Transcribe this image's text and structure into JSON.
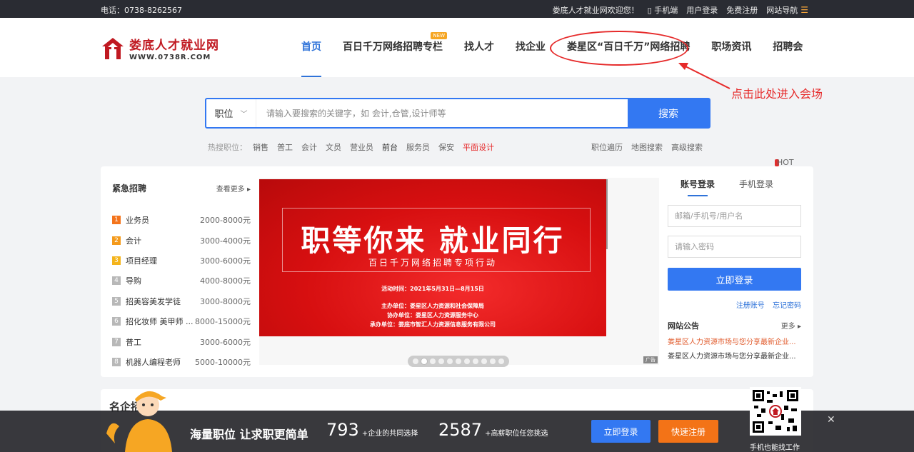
{
  "topbar": {
    "phone": "电话：0738-8262567",
    "welcome": "娄底人才就业网欢迎您！",
    "mobile": "手机端",
    "user_login": "用户登录",
    "free_register": "免费注册",
    "site_nav": "网站导航"
  },
  "logo": {
    "cn": "娄底人才就业网",
    "en": "WWW.0738R.COM"
  },
  "nav": {
    "items": [
      {
        "label": "首页"
      },
      {
        "label": "百日千万网络招聘专栏",
        "badge": "NEW"
      },
      {
        "label": "找人才"
      },
      {
        "label": "找企业"
      },
      {
        "label": "娄星区“百日千万”网络招聘",
        "badge": "HOT"
      },
      {
        "label": "职场资讯"
      },
      {
        "label": "招聘会"
      }
    ],
    "annotation": "点击此处进入会场"
  },
  "search": {
    "type": "职位",
    "placeholder": "请输入要搜索的关键字，如 会计,仓管,设计师等",
    "button": "搜索"
  },
  "hot": {
    "label": "热搜职位：",
    "items": [
      "销售",
      "普工",
      "会计",
      "文员",
      "营业员",
      "前台",
      "服务员",
      "保安",
      "平面设计"
    ],
    "links": [
      "职位遍历",
      "地图搜索",
      "高级搜索"
    ]
  },
  "urgent": {
    "title": "紧急招聘",
    "more": "查看更多",
    "items": [
      {
        "rank": "1",
        "job": "业务员",
        "salary": "2000-8000元"
      },
      {
        "rank": "2",
        "job": "会计",
        "salary": "3000-4000元"
      },
      {
        "rank": "3",
        "job": "项目经理",
        "salary": "3000-6000元"
      },
      {
        "rank": "4",
        "job": "导购",
        "salary": "4000-8000元"
      },
      {
        "rank": "5",
        "job": "招美容美发学徒",
        "salary": "3000-8000元"
      },
      {
        "rank": "6",
        "job": "招化妆师 美甲师 ...",
        "salary": "8000-15000元"
      },
      {
        "rank": "7",
        "job": "普工",
        "salary": "3000-6000元"
      },
      {
        "rank": "8",
        "job": "机器人编程老师",
        "salary": "5000-10000元"
      }
    ]
  },
  "banner": {
    "headline": "职等你来  就业同行",
    "subtitle": "百日千万网络招聘专项行动",
    "lines": [
      "活动时间：2021年5月31日—8月15日",
      "主办单位：娄星区人力资源和社会保障局",
      "协办单位：娄星区人力资源服务中心",
      "承办单位：娄底市智汇人力资源信息服务有限公司"
    ],
    "ad": "广告"
  },
  "login": {
    "tab_account": "账号登录",
    "tab_phone": "手机登录",
    "username_placeholder": "邮箱/手机号/用户名",
    "password_placeholder": "请输入密码",
    "button": "立即登录",
    "register": "注册账号",
    "forgot": "忘记密码"
  },
  "notice": {
    "title": "网站公告",
    "more": "更多",
    "items": [
      "娄星区人力资源市场与您分享最新企业...",
      "娄星区人力资源市场与您分享最新企业..."
    ]
  },
  "famous": {
    "title": "名企招"
  },
  "bottom": {
    "slogan": "海量职位 让求职更简单",
    "stat1_num": "793",
    "stat1_txt": "+企业的共同选择",
    "stat2_num": "2587",
    "stat2_txt": "+高薪职位任您挑选",
    "login": "立即登录",
    "register": "快速注册",
    "qr_caption": "手机也能找工作"
  },
  "colors": {
    "accent": "#3378f2",
    "brand": "#c01921",
    "annotation": "#e62a2a",
    "orange": "#f37317"
  }
}
